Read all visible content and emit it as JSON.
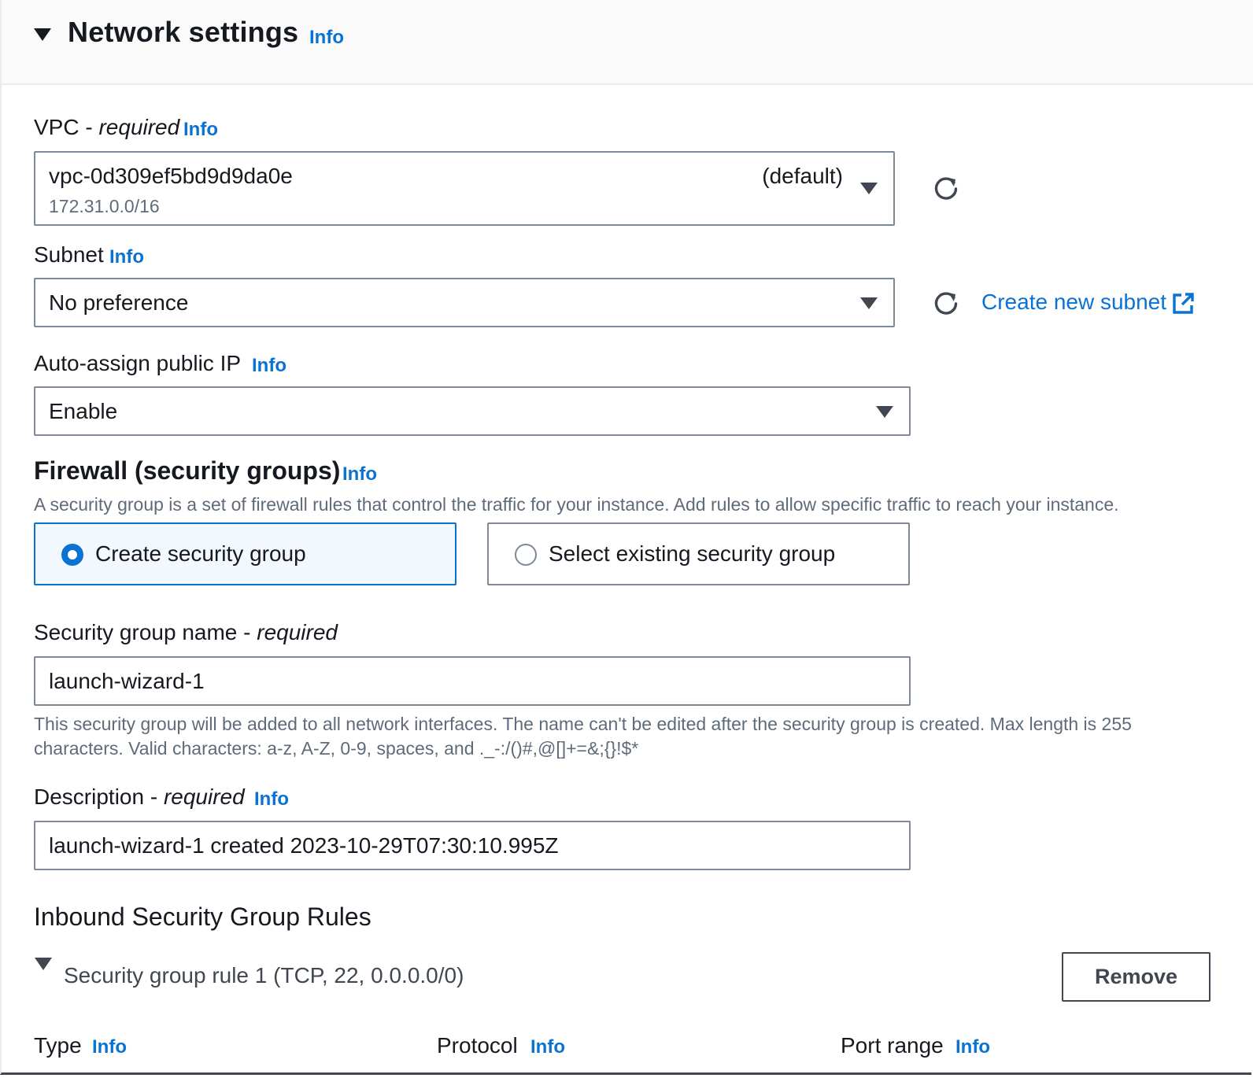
{
  "header": {
    "title": "Network settings",
    "info": "Info"
  },
  "vpc": {
    "label": "VPC - ",
    "required": "required",
    "info": "Info",
    "value": "vpc-0d309ef5bd9d9da0e",
    "tag": "(default)",
    "cidr": "172.31.0.0/16"
  },
  "subnet": {
    "label": "Subnet",
    "info": "Info",
    "value": "No preference",
    "create_link": "Create new subnet"
  },
  "public_ip": {
    "label": "Auto-assign public IP",
    "info": "Info",
    "value": "Enable"
  },
  "firewall": {
    "title": "Firewall (security groups)",
    "info": "Info",
    "description": "A security group is a set of firewall rules that control the traffic for your instance. Add rules to allow specific traffic to reach your instance.",
    "options": [
      {
        "label": "Create security group",
        "selected": true
      },
      {
        "label": "Select existing security group",
        "selected": false
      }
    ]
  },
  "sg_name": {
    "label": "Security group name - ",
    "required": "required",
    "value": "launch-wizard-1",
    "help_line1": "This security group will be added to all network interfaces. The name can't be edited after the security group is created. Max length is 255",
    "help_line2": "characters. Valid characters: a-z, A-Z, 0-9, spaces, and ._-:/()#,@[]+=&;{}!$*"
  },
  "description": {
    "label": "Description - ",
    "required": "required",
    "info": "Info",
    "value": "launch-wizard-1 created 2023-10-29T07:30:10.995Z"
  },
  "inbound": {
    "title": "Inbound Security Group Rules",
    "rule_title": "Security group rule 1 (TCP, 22, 0.0.0.0/0)",
    "remove_label": "Remove",
    "columns": [
      {
        "label": "Type",
        "info": "Info"
      },
      {
        "label": "Protocol",
        "info": "Info"
      },
      {
        "label": "Port range",
        "info": "Info"
      }
    ]
  },
  "colors": {
    "link": "#0972d3",
    "text": "#16191f",
    "muted": "#5f6b7a",
    "border": "#7d8998",
    "selected_bg": "#f2f8fd"
  },
  "icons": {
    "collapse": "caret-down-icon",
    "dropdown": "triangle-down-icon",
    "refresh": "refresh-icon",
    "external": "external-link-icon",
    "radio": "radio-icon"
  }
}
